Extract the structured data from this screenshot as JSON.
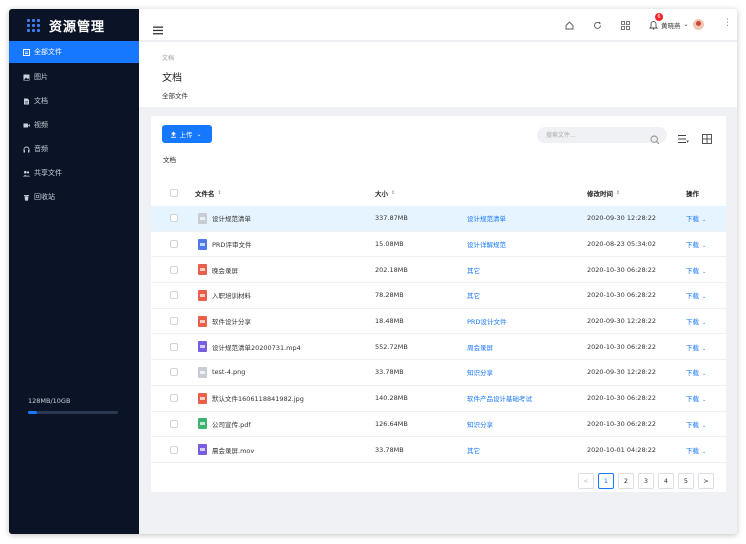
{
  "app": {
    "title": "资源管理"
  },
  "sidebar": {
    "items": [
      {
        "label": "全部文件",
        "icon": "all-files-icon",
        "active": true
      },
      {
        "label": "图片",
        "icon": "image-icon",
        "active": false
      },
      {
        "label": "文档",
        "icon": "document-icon",
        "active": false
      },
      {
        "label": "视频",
        "icon": "video-icon",
        "active": false
      },
      {
        "label": "音频",
        "icon": "audio-icon",
        "active": false
      },
      {
        "label": "共享文件",
        "icon": "shared-icon",
        "active": false
      },
      {
        "label": "回收站",
        "icon": "trash-icon",
        "active": false
      }
    ],
    "storage": {
      "text": "128MB/10GB",
      "fraction": 0.1
    }
  },
  "topbar": {
    "notification_count": "6",
    "user_name": "黄晓燕",
    "icons": [
      "home-icon",
      "refresh-icon",
      "apps-icon",
      "bell-icon"
    ]
  },
  "page_header": {
    "breadcrumb": "文档",
    "title": "文档",
    "subtitle": "全部文件"
  },
  "toolbar": {
    "upload_label": "上传",
    "folder_label": "文档",
    "search_placeholder": "搜索文件..."
  },
  "table": {
    "columns": {
      "name": "文件名",
      "size": "大小",
      "modified": "修改时间",
      "action": "操作"
    },
    "rows": [
      {
        "name": "设计规范清单",
        "size": "337.87MB",
        "category": "设计规范清单",
        "modified": "2020-09-30  12:28:22",
        "action": "下载",
        "color": "#c8ccd4",
        "selected": true
      },
      {
        "name": "PRD评审文件",
        "size": "15.08MB",
        "category": "设计详解规范",
        "modified": "2020-08-23 05:34:02",
        "action": "下载",
        "color": "#4e7be8",
        "selected": false
      },
      {
        "name": "晚会录屏",
        "size": "202.18MB",
        "category": "其它",
        "modified": "2020-10-30  06:28:22",
        "action": "下载",
        "color": "#e8604c",
        "selected": false
      },
      {
        "name": "入职培训材料",
        "size": "78.28MB",
        "category": "其它",
        "modified": "2020-10-30  06:28:22",
        "action": "下载",
        "color": "#e8604c",
        "selected": false
      },
      {
        "name": "软件设计分享",
        "size": "18.48MB",
        "category": "PRD设计文件",
        "modified": "2020-09-30  12:28:22",
        "action": "下载",
        "color": "#e8604c",
        "selected": false
      },
      {
        "name": "设计规范清单20200731.mp4",
        "size": "552.72MB",
        "category": "周会录屏",
        "modified": "2020-10-30  06:28:22",
        "action": "下载",
        "color": "#7a5ce0",
        "selected": false
      },
      {
        "name": "test-4.png",
        "size": "33.78MB",
        "category": "知识分享",
        "modified": "2020-09-30  12:28:22",
        "action": "下载",
        "color": "#c8ccd4",
        "selected": false
      },
      {
        "name": "默认文件1606118841982.jpg",
        "size": "140.28MB",
        "category": "软件产品设计基础考试",
        "modified": "2020-10-30  06:28:22",
        "action": "下载",
        "color": "#e8604c",
        "selected": false
      },
      {
        "name": "公司宣传.pdf",
        "size": "126.64MB",
        "category": "知识分享",
        "modified": "2020-10-30  06:28:22",
        "action": "下载",
        "color": "#3cb371",
        "selected": false
      },
      {
        "name": "晨会录屏.mov",
        "size": "33.78MB",
        "category": "其它",
        "modified": "2020-10-01  04:28:22",
        "action": "下载",
        "color": "#7a5ce0",
        "selected": false
      }
    ]
  },
  "pagination": {
    "prev": "<",
    "pages": [
      "1",
      "2",
      "3",
      "4",
      "5"
    ],
    "current": "1",
    "next": ">"
  }
}
